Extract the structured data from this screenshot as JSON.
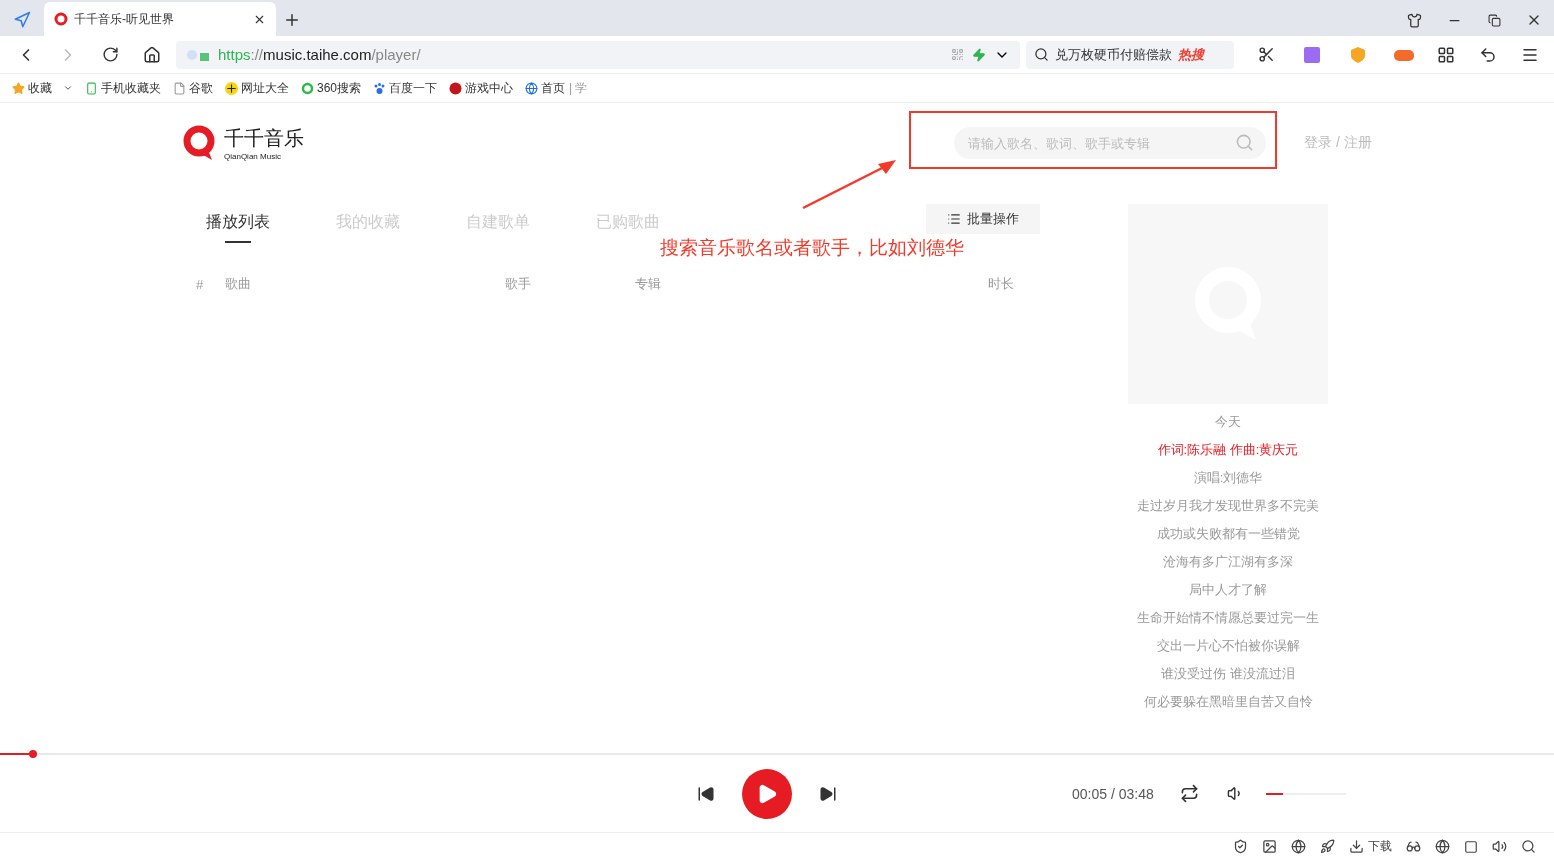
{
  "browser": {
    "tab_title": "千千音乐-听见世界",
    "url": {
      "scheme": "https",
      "sep": "://",
      "host": "music.taihe.com",
      "path": "/player/"
    },
    "hot_search": {
      "text": "兑万枚硬币付赔偿款",
      "badge": "热搜"
    },
    "bookmarks": [
      "收藏",
      "手机收藏夹",
      "谷歌",
      "网址大全",
      "360搜索",
      "百度一下",
      "游戏中心",
      "首页"
    ],
    "bookmarks_more": "| 学"
  },
  "page": {
    "logo": {
      "name": "千千音乐",
      "subtitle": "QianQian Music"
    },
    "search": {
      "placeholder": "请输入歌名、歌词、歌手或专辑"
    },
    "login": "登录 / 注册",
    "tabs": [
      {
        "label": "播放列表",
        "selected": true
      },
      {
        "label": "我的收藏",
        "selected": false
      },
      {
        "label": "自建歌单",
        "selected": false
      },
      {
        "label": "已购歌曲",
        "selected": false
      }
    ],
    "batch_button": "批量操作",
    "columns": [
      "#",
      "歌曲",
      "歌手",
      "专辑",
      "时长"
    ],
    "lyrics": [
      {
        "text": "今天",
        "current": false
      },
      {
        "text": "作词:陈乐融 作曲:黄庆元",
        "current": true
      },
      {
        "text": "演唱:刘德华",
        "current": false
      },
      {
        "text": "走过岁月我才发现世界多不完美",
        "current": false
      },
      {
        "text": "成功或失败都有一些错觉",
        "current": false
      },
      {
        "text": "沧海有多广江湖有多深",
        "current": false
      },
      {
        "text": "局中人才了解",
        "current": false
      },
      {
        "text": "生命开始情不情愿总要过完一生",
        "current": false
      },
      {
        "text": "交出一片心不怕被你误解",
        "current": false
      },
      {
        "text": "谁没受过伤 谁没流过泪",
        "current": false
      },
      {
        "text": "何必要躲在黑暗里自苦又自怜",
        "current": false
      }
    ],
    "player": {
      "time": "00:05 / 03:48",
      "volume": {
        "level": 0.22
      }
    },
    "annotation": "搜索音乐歌名或者歌手，比如刘德华"
  },
  "status_bar": {
    "download": "下载"
  }
}
